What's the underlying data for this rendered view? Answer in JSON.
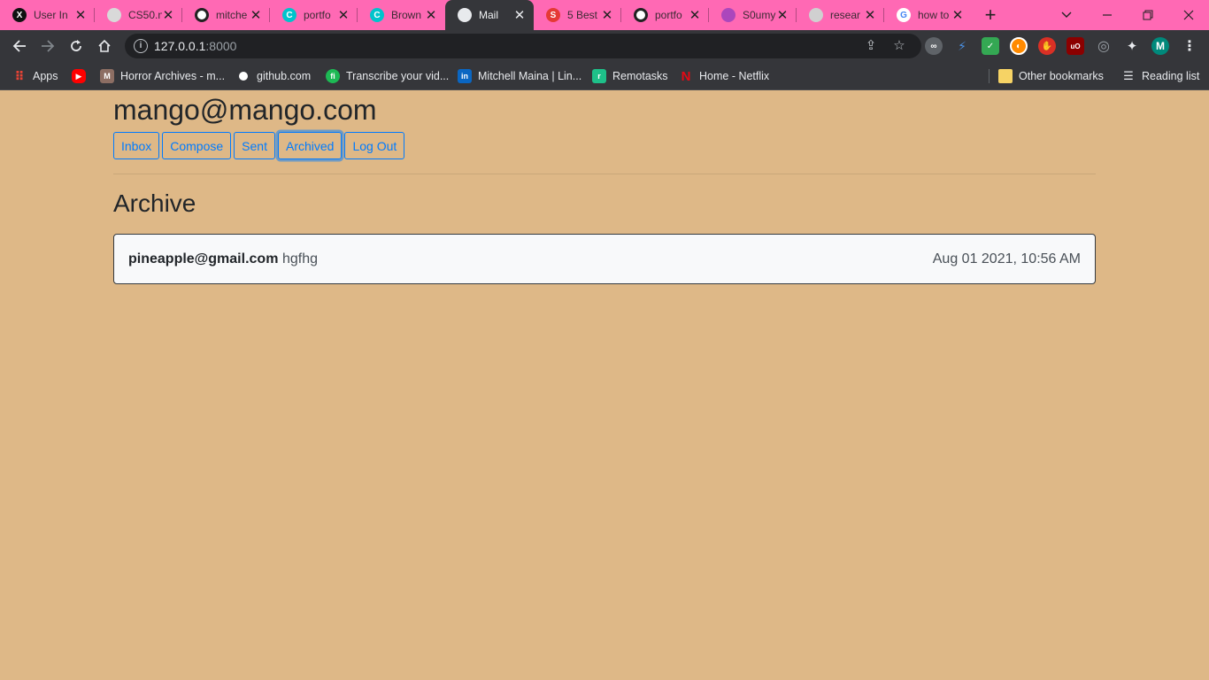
{
  "browser": {
    "tabs": [
      {
        "title": "User Int",
        "icon": "x-logo-icon",
        "color": "#111111"
      },
      {
        "title": "CS50.n",
        "icon": "globe-icon",
        "color": "#c0c0c0"
      },
      {
        "title": "mitche",
        "icon": "github-icon",
        "color": "#ffffff"
      },
      {
        "title": "portfo",
        "icon": "canva-icon",
        "color": "#00c4cc"
      },
      {
        "title": "Brown",
        "icon": "canva-icon",
        "color": "#00c4cc"
      },
      {
        "title": "Mail",
        "icon": "globe-icon",
        "color": "#e8eaed",
        "active": true
      },
      {
        "title": "5 Best",
        "icon": "s-logo-icon",
        "color": "#e53935"
      },
      {
        "title": "portfo",
        "icon": "github-icon",
        "color": "#ffffff"
      },
      {
        "title": "S0umy",
        "icon": "pink-logo-icon",
        "color": "#ab47bc"
      },
      {
        "title": "resear",
        "icon": "globe-icon",
        "color": "#d0d0d0"
      },
      {
        "title": "how to",
        "icon": "google-icon",
        "color": "#4285f4"
      }
    ],
    "url_host": "127.0.0.1",
    "url_port": ":8000",
    "profile_initial": "M",
    "bookmarks": [
      {
        "label": "Apps",
        "icon": "apps-grid-icon"
      },
      {
        "label": "",
        "icon": "youtube-icon"
      },
      {
        "label": "Horror Archives - m...",
        "icon": "horror-archives-icon"
      },
      {
        "label": "github.com",
        "icon": "github-icon"
      },
      {
        "label": "Transcribe your vid...",
        "icon": "transcribe-icon"
      },
      {
        "label": "Mitchell Maina | Lin...",
        "icon": "linkedin-icon"
      },
      {
        "label": "Remotasks",
        "icon": "remotasks-icon"
      },
      {
        "label": "Home - Netflix",
        "icon": "netflix-icon"
      }
    ],
    "other_bookmarks": "Other bookmarks",
    "reading_list": "Reading list"
  },
  "mail": {
    "user_email": "mango@mango.com",
    "nav_buttons": [
      "Inbox",
      "Compose",
      "Sent",
      "Archived",
      "Log Out"
    ],
    "active_button": "Archived",
    "section_title": "Archive",
    "emails": [
      {
        "sender": "pineapple@gmail.com",
        "subject": "hgfhg",
        "timestamp": "Aug 01 2021, 10:56 AM"
      }
    ]
  },
  "colors": {
    "page_bg": "#deb887",
    "tabstrip_bg": "#ff69b4",
    "chrome_dark": "#35363a",
    "primary": "#007bff"
  }
}
